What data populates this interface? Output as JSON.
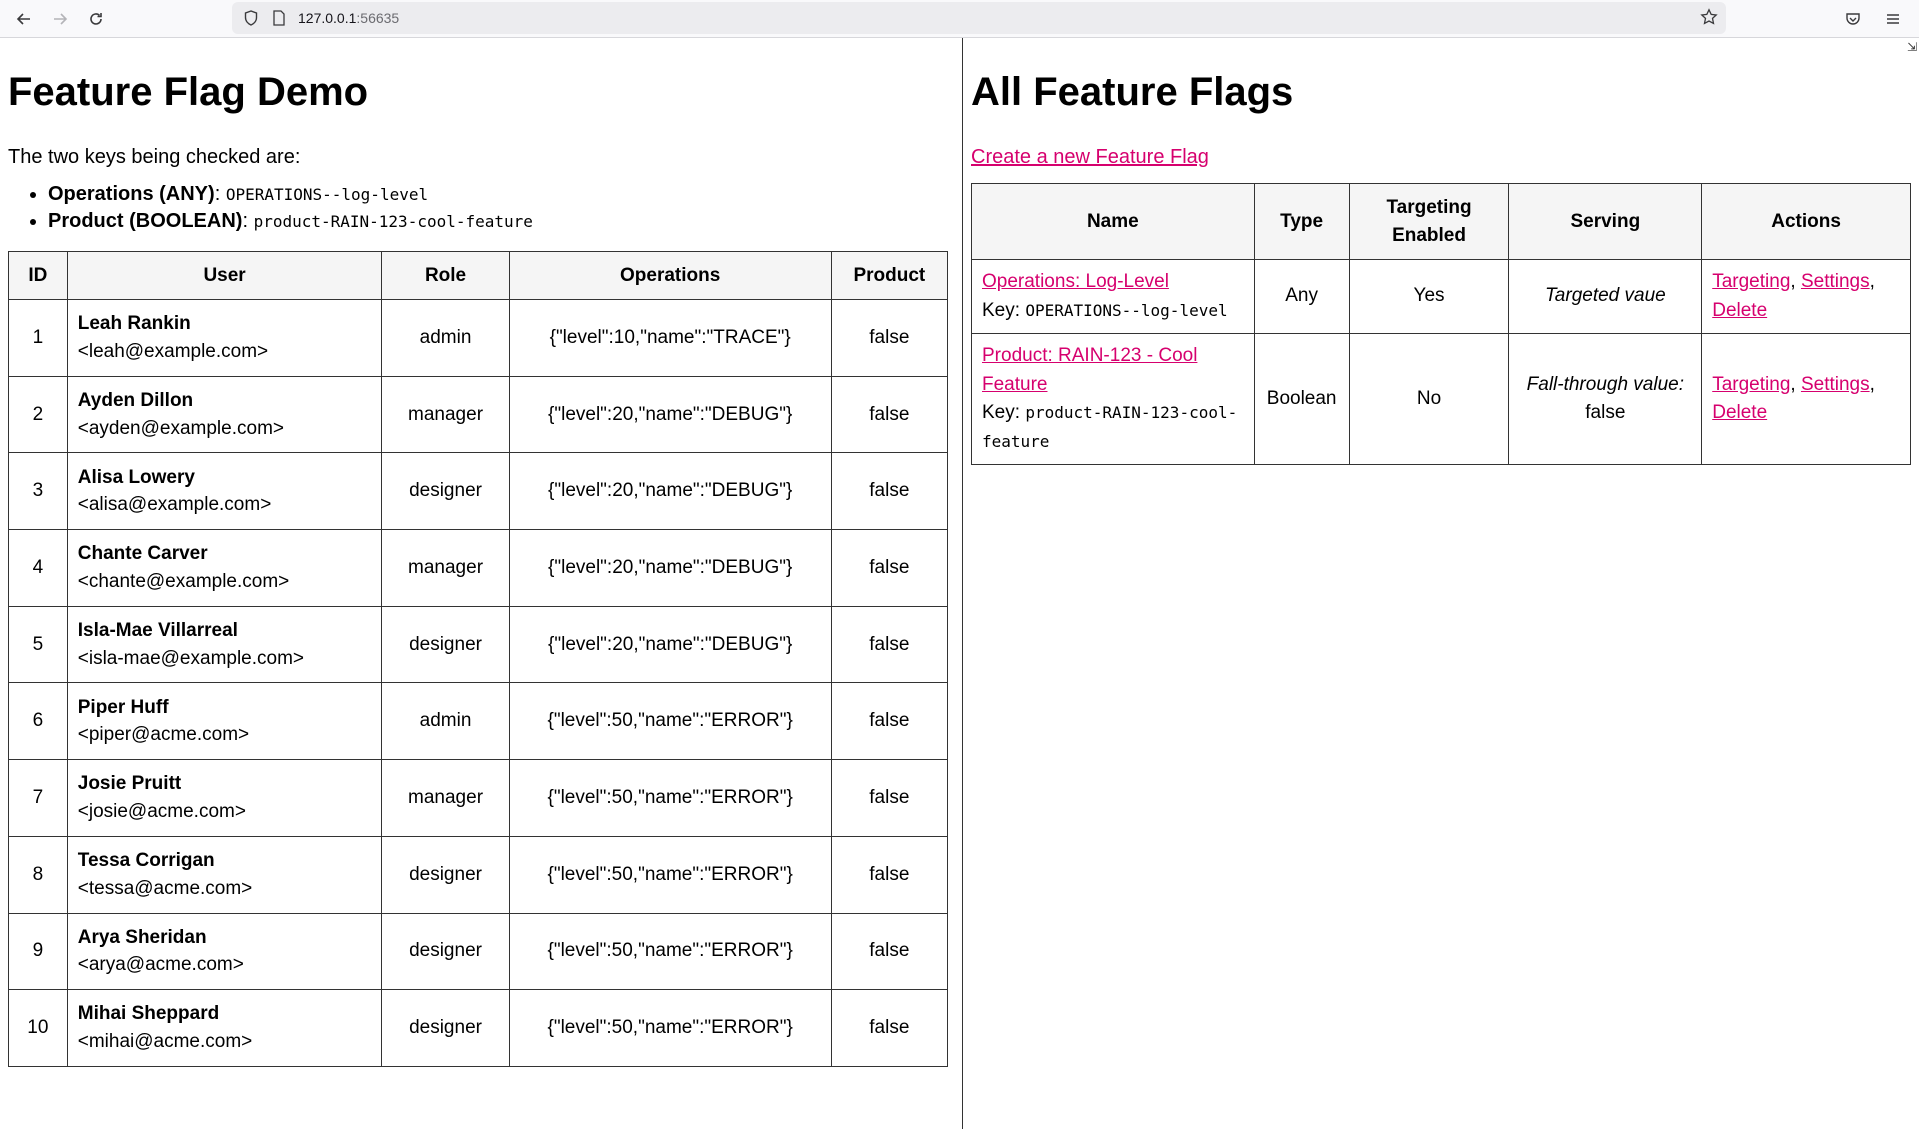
{
  "browser": {
    "url_host": "127.0.0.1",
    "url_port": ":56635"
  },
  "left": {
    "title": "Feature Flag Demo",
    "intro": "The two keys being checked are:",
    "keys": [
      {
        "label": "Operations (ANY)",
        "sep": ":",
        "code": "OPERATIONS--log-level"
      },
      {
        "label": "Product (BOOLEAN)",
        "sep": ":",
        "code": "product-RAIN-123-cool-feature"
      }
    ],
    "table": {
      "headers": [
        "ID",
        "User",
        "Role",
        "Operations",
        "Product"
      ],
      "rows": [
        {
          "id": "1",
          "name": "Leah Rankin",
          "email": "<leah@example.com>",
          "role": "admin",
          "ops": "{\"level\":10,\"name\":\"TRACE\"}",
          "product": "false"
        },
        {
          "id": "2",
          "name": "Ayden Dillon",
          "email": "<ayden@example.com>",
          "role": "manager",
          "ops": "{\"level\":20,\"name\":\"DEBUG\"}",
          "product": "false"
        },
        {
          "id": "3",
          "name": "Alisa Lowery",
          "email": "<alisa@example.com>",
          "role": "designer",
          "ops": "{\"level\":20,\"name\":\"DEBUG\"}",
          "product": "false"
        },
        {
          "id": "4",
          "name": "Chante Carver",
          "email": "<chante@example.com>",
          "role": "manager",
          "ops": "{\"level\":20,\"name\":\"DEBUG\"}",
          "product": "false"
        },
        {
          "id": "5",
          "name": "Isla-Mae Villarreal",
          "email": "<isla-mae@example.com>",
          "role": "designer",
          "ops": "{\"level\":20,\"name\":\"DEBUG\"}",
          "product": "false"
        },
        {
          "id": "6",
          "name": "Piper Huff",
          "email": "<piper@acme.com>",
          "role": "admin",
          "ops": "{\"level\":50,\"name\":\"ERROR\"}",
          "product": "false"
        },
        {
          "id": "7",
          "name": "Josie Pruitt",
          "email": "<josie@acme.com>",
          "role": "manager",
          "ops": "{\"level\":50,\"name\":\"ERROR\"}",
          "product": "false"
        },
        {
          "id": "8",
          "name": "Tessa Corrigan",
          "email": "<tessa@acme.com>",
          "role": "designer",
          "ops": "{\"level\":50,\"name\":\"ERROR\"}",
          "product": "false"
        },
        {
          "id": "9",
          "name": "Arya Sheridan",
          "email": "<arya@acme.com>",
          "role": "designer",
          "ops": "{\"level\":50,\"name\":\"ERROR\"}",
          "product": "false"
        },
        {
          "id": "10",
          "name": "Mihai Sheppard",
          "email": "<mihai@acme.com>",
          "role": "designer",
          "ops": "{\"level\":50,\"name\":\"ERROR\"}",
          "product": "false"
        }
      ]
    }
  },
  "right": {
    "title": "All Feature Flags",
    "create_link": "Create a new Feature Flag",
    "table": {
      "headers": [
        "Name",
        "Type",
        "Targeting Enabled",
        "Serving",
        "Actions"
      ],
      "rows": [
        {
          "name": "Operations: Log-Level",
          "key_label": "Key:",
          "key": "OPERATIONS--log-level",
          "type": "Any",
          "targeting": "Yes",
          "serving_label": "Targeted vaue",
          "serving_value": "",
          "actions": [
            "Targeting",
            "Settings",
            "Delete"
          ]
        },
        {
          "name": "Product: RAIN-123 - Cool Feature",
          "key_label": "Key:",
          "key": "product-RAIN-123-cool-feature",
          "type": "Boolean",
          "targeting": "No",
          "serving_label": "Fall-through value:",
          "serving_value": "false",
          "actions": [
            "Targeting",
            "Settings",
            "Delete"
          ]
        }
      ]
    }
  }
}
